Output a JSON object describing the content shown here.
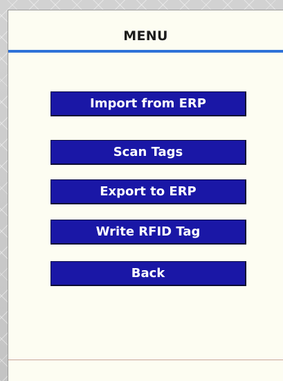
{
  "menu": {
    "title": "MENU",
    "buttons": [
      {
        "label": "Import from ERP"
      },
      {
        "label": "Scan Tags"
      },
      {
        "label": "Export to ERP"
      },
      {
        "label": "Write RFID Tag"
      },
      {
        "label": "Back"
      }
    ]
  },
  "colors": {
    "button_fill": "#1a17a6",
    "title_rule": "#2f72d8",
    "screen_background": "#fdfdf2"
  }
}
